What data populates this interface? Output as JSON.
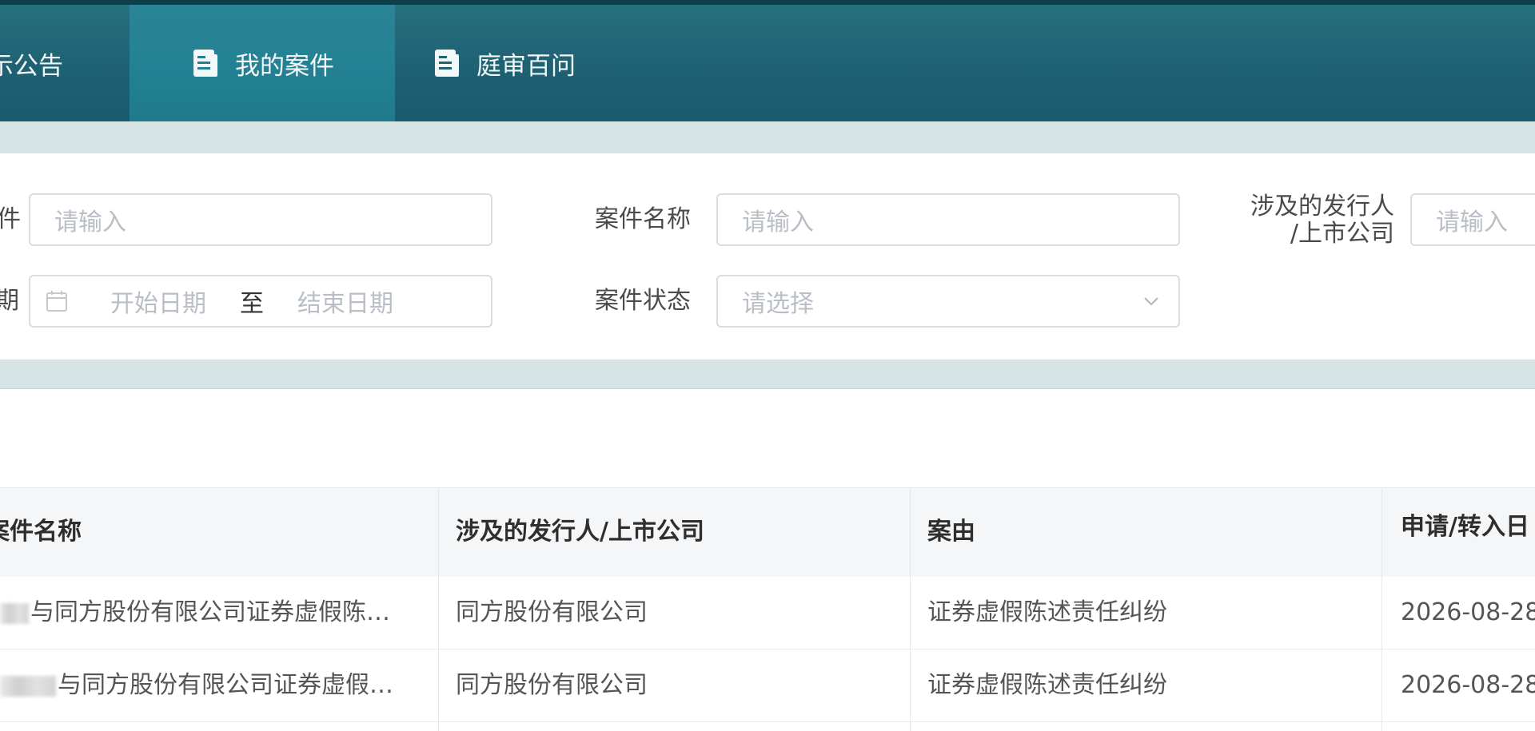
{
  "nav": {
    "tabs": [
      {
        "label": "示公告",
        "active": false
      },
      {
        "label": "我的案件",
        "active": true
      },
      {
        "label": "庭审百问",
        "active": false
      }
    ]
  },
  "filters": {
    "row1": {
      "field1_label": "件",
      "field1_placeholder": "请输入",
      "case_name_label": "案件名称",
      "case_name_placeholder": "请输入",
      "issuer_label_line1": "涉及的发行人",
      "issuer_label_line2": "/上市公司",
      "issuer_placeholder": "请输入"
    },
    "row2": {
      "date_label": "期",
      "date_start": "开始日期",
      "date_sep": "至",
      "date_end": "结束日期",
      "status_label": "案件状态",
      "status_placeholder": "请选择"
    }
  },
  "table": {
    "columns": [
      "案件名称",
      "涉及的发行人/上市公司",
      "案由",
      "申请/转入日"
    ],
    "rows": [
      {
        "name": "与同方股份有限公司证券虚假陈…",
        "issuer": "同方股份有限公司",
        "cause": "证券虚假陈述责任纠纷",
        "date": "2026-08-28"
      },
      {
        "name": "与同方股份有限公司证券虚假…",
        "issuer": "同方股份有限公司",
        "cause": "证券虚假陈述责任纠纷",
        "date": "2026-08-28"
      }
    ]
  },
  "colors": {
    "nav_bg": "#1f6274",
    "nav_active": "#238093",
    "band": "#d6e4e5"
  }
}
